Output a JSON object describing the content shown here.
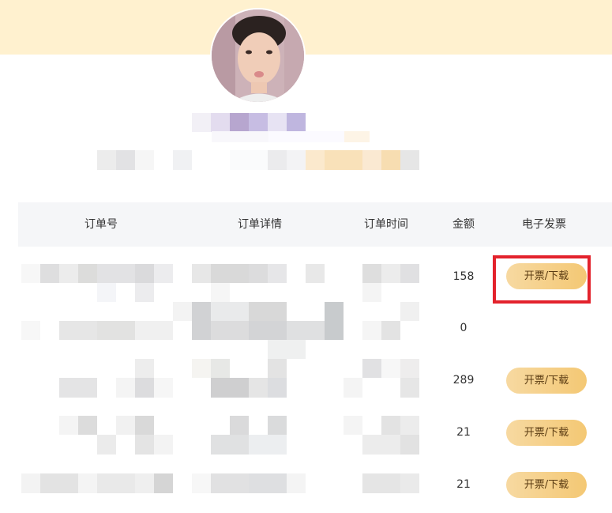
{
  "table": {
    "headers": {
      "order_no": "订单号",
      "order_detail": "订单详情",
      "order_time": "订单时间",
      "amount": "金额",
      "invoice": "电子发票"
    },
    "rows": [
      {
        "amount": "158",
        "invoice_label": "开票/下载"
      },
      {
        "amount": "0",
        "invoice_label": ""
      },
      {
        "amount": "289",
        "invoice_label": "开票/下载"
      },
      {
        "amount": "21",
        "invoice_label": "开票/下载"
      },
      {
        "amount": "21",
        "invoice_label": "开票/下载"
      }
    ]
  },
  "colors": {
    "top_band": "#fff1cf",
    "header_bg": "#f5f6f8",
    "button_gradient_start": "#f7d9a1",
    "button_gradient_end": "#f4c874",
    "highlight": "#e3222c"
  }
}
